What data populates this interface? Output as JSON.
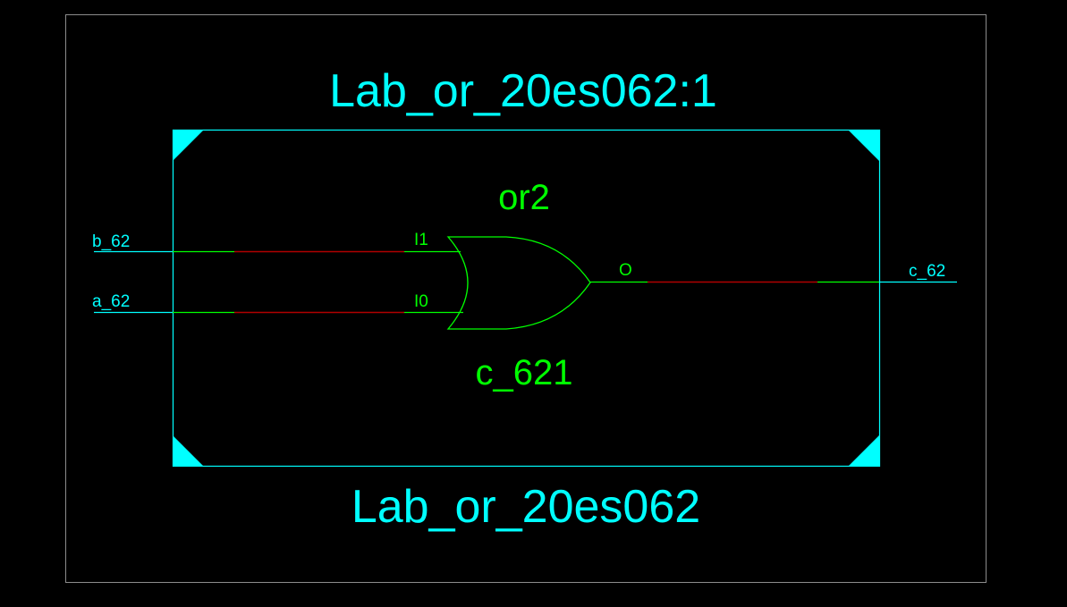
{
  "schematic": {
    "instance_name": "Lab_or_20es062:1",
    "module_name": "Lab_or_20es062",
    "gate": {
      "type_label": "or2",
      "instance_label": "c_621",
      "pin_in1": "I1",
      "pin_in0": "I0",
      "pin_out": "O"
    },
    "ports": {
      "input_b": "b_62",
      "input_a": "a_62",
      "output_c": "c_62"
    }
  },
  "colors": {
    "background": "#000000",
    "frame": "#8c8c8c",
    "module": "#00ffff",
    "gate": "#00ff00",
    "net_highlight": "#b00000"
  }
}
